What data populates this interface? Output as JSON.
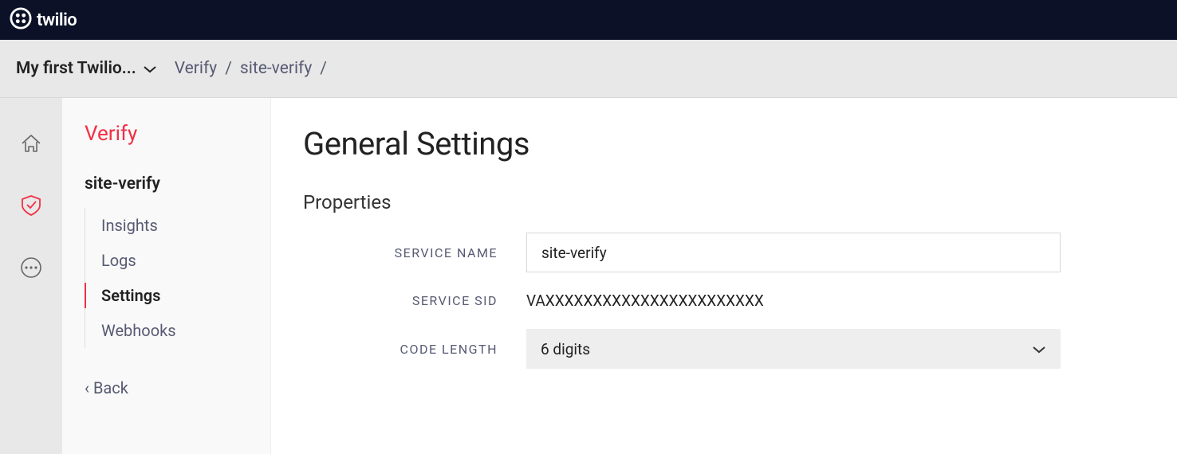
{
  "header": {
    "brand": "twilio"
  },
  "breadcrumb": {
    "account": "My first Twilio...",
    "items": [
      "Verify",
      "site-verify"
    ]
  },
  "sidebar": {
    "title": "Verify",
    "subtitle": "site-verify",
    "items": [
      {
        "label": "Insights",
        "active": false
      },
      {
        "label": "Logs",
        "active": false
      },
      {
        "label": "Settings",
        "active": true
      },
      {
        "label": "Webhooks",
        "active": false
      }
    ],
    "back_label": "‹ Back"
  },
  "main": {
    "title": "General Settings",
    "section": "Properties",
    "form": {
      "service_name": {
        "label": "SERVICE NAME",
        "value": "site-verify"
      },
      "service_sid": {
        "label": "SERVICE SID",
        "value": "VAXXXXXXXXXXXXXXXXXXXXXXX"
      },
      "code_length": {
        "label": "CODE LENGTH",
        "value": "6 digits"
      }
    }
  }
}
